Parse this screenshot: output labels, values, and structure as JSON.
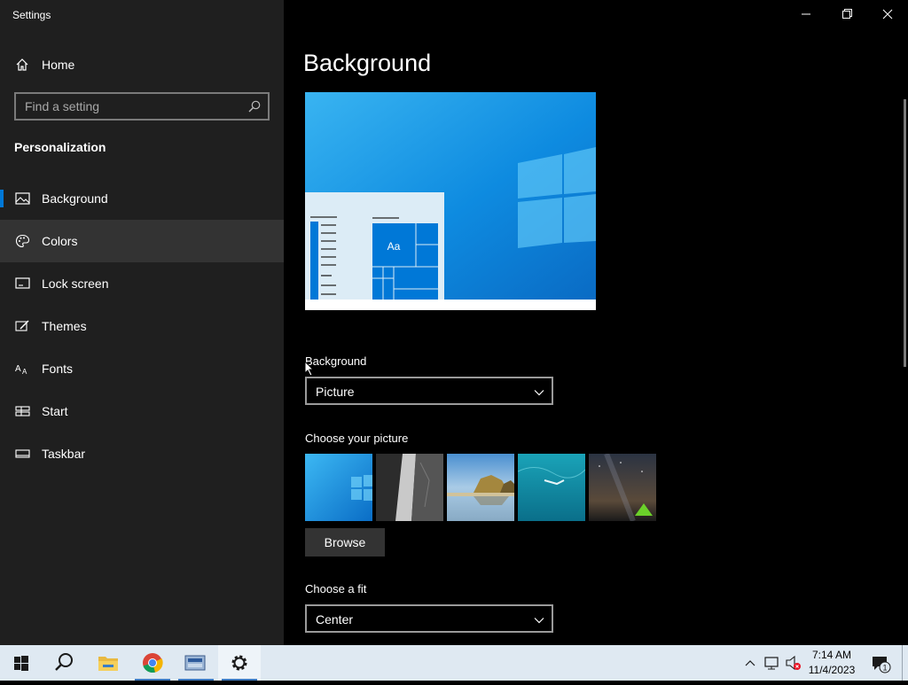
{
  "window": {
    "title": "Settings"
  },
  "sidebar": {
    "home_label": "Home",
    "search_placeholder": "Find a setting",
    "section_title": "Personalization",
    "items": [
      {
        "label": "Background",
        "icon": "picture-icon",
        "selected": true
      },
      {
        "label": "Colors",
        "icon": "palette-icon",
        "hover": true
      },
      {
        "label": "Lock screen",
        "icon": "lock-screen-icon"
      },
      {
        "label": "Themes",
        "icon": "brush-icon"
      },
      {
        "label": "Fonts",
        "icon": "fonts-icon"
      },
      {
        "label": "Start",
        "icon": "start-layout-icon"
      },
      {
        "label": "Taskbar",
        "icon": "taskbar-icon"
      }
    ]
  },
  "main": {
    "title": "Background",
    "preview": {
      "tile_text": "Aa"
    },
    "background_label": "Background",
    "background_value": "Picture",
    "choose_picture_label": "Choose your picture",
    "pictures": [
      "windows-light-blue",
      "rock-cliff",
      "beach-rocks",
      "underwater-swimmer",
      "night-sky-tent"
    ],
    "browse_label": "Browse",
    "fit_label": "Choose a fit",
    "fit_value": "Center"
  },
  "taskbar": {
    "apps": [
      "start-icon",
      "search-icon",
      "file-explorer-icon",
      "chrome-icon",
      "network-app-icon",
      "settings-icon"
    ],
    "active_app": "settings-icon",
    "time": "7:14 AM",
    "date": "11/4/2023",
    "notification_count": "1"
  },
  "colors": {
    "accent": "#0078d7",
    "sidebar_bg": "#1f1f1f",
    "main_bg": "#000000",
    "taskbar_bg": "#dfe9f2"
  }
}
